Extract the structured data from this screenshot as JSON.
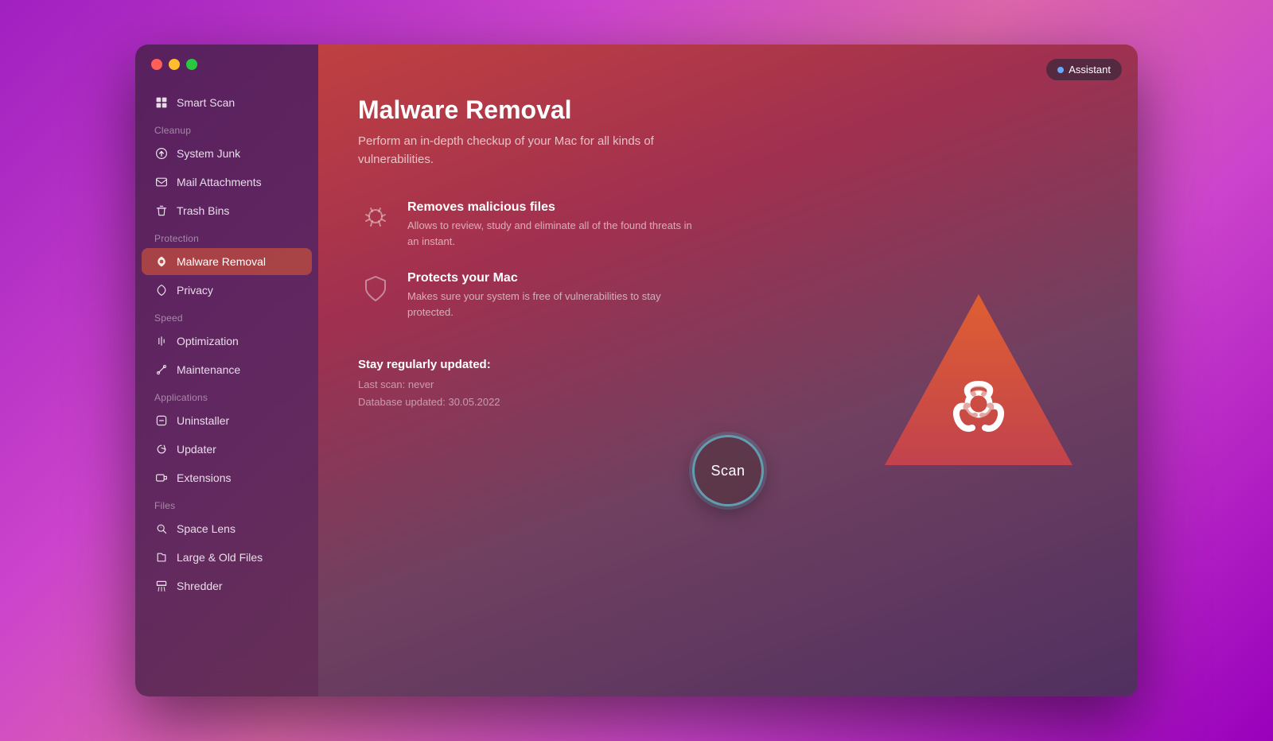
{
  "window": {
    "traffic_lights": [
      "red",
      "yellow",
      "green"
    ]
  },
  "assistant_button": {
    "label": "Assistant",
    "dot_color": "#66aaff"
  },
  "sidebar": {
    "smart_scan": "Smart Scan",
    "sections": [
      {
        "label": "Cleanup",
        "items": [
          {
            "id": "system-junk",
            "label": "System Junk",
            "icon": "junk"
          },
          {
            "id": "mail-attachments",
            "label": "Mail Attachments",
            "icon": "mail"
          },
          {
            "id": "trash-bins",
            "label": "Trash Bins",
            "icon": "trash"
          }
        ]
      },
      {
        "label": "Protection",
        "items": [
          {
            "id": "malware-removal",
            "label": "Malware Removal",
            "icon": "malware",
            "active": true
          },
          {
            "id": "privacy",
            "label": "Privacy",
            "icon": "privacy"
          }
        ]
      },
      {
        "label": "Speed",
        "items": [
          {
            "id": "optimization",
            "label": "Optimization",
            "icon": "optimization"
          },
          {
            "id": "maintenance",
            "label": "Maintenance",
            "icon": "maintenance"
          }
        ]
      },
      {
        "label": "Applications",
        "items": [
          {
            "id": "uninstaller",
            "label": "Uninstaller",
            "icon": "uninstaller"
          },
          {
            "id": "updater",
            "label": "Updater",
            "icon": "updater"
          },
          {
            "id": "extensions",
            "label": "Extensions",
            "icon": "extensions"
          }
        ]
      },
      {
        "label": "Files",
        "items": [
          {
            "id": "space-lens",
            "label": "Space Lens",
            "icon": "space"
          },
          {
            "id": "large-old-files",
            "label": "Large & Old Files",
            "icon": "files"
          },
          {
            "id": "shredder",
            "label": "Shredder",
            "icon": "shredder"
          }
        ]
      }
    ]
  },
  "main": {
    "title": "Malware Removal",
    "subtitle": "Perform an in-depth checkup of your Mac for all kinds of vulnerabilities.",
    "features": [
      {
        "id": "removes-malicious",
        "title": "Removes malicious files",
        "description": "Allows to review, study and eliminate all of the found threats in an instant."
      },
      {
        "id": "protects-mac",
        "title": "Protects your Mac",
        "description": "Makes sure your system is free of vulnerabilities to stay protected."
      }
    ],
    "status": {
      "title": "Stay regularly updated:",
      "last_scan": "Last scan: never",
      "db_updated": "Database updated: 30.05.2022"
    },
    "scan_button": "Scan"
  }
}
